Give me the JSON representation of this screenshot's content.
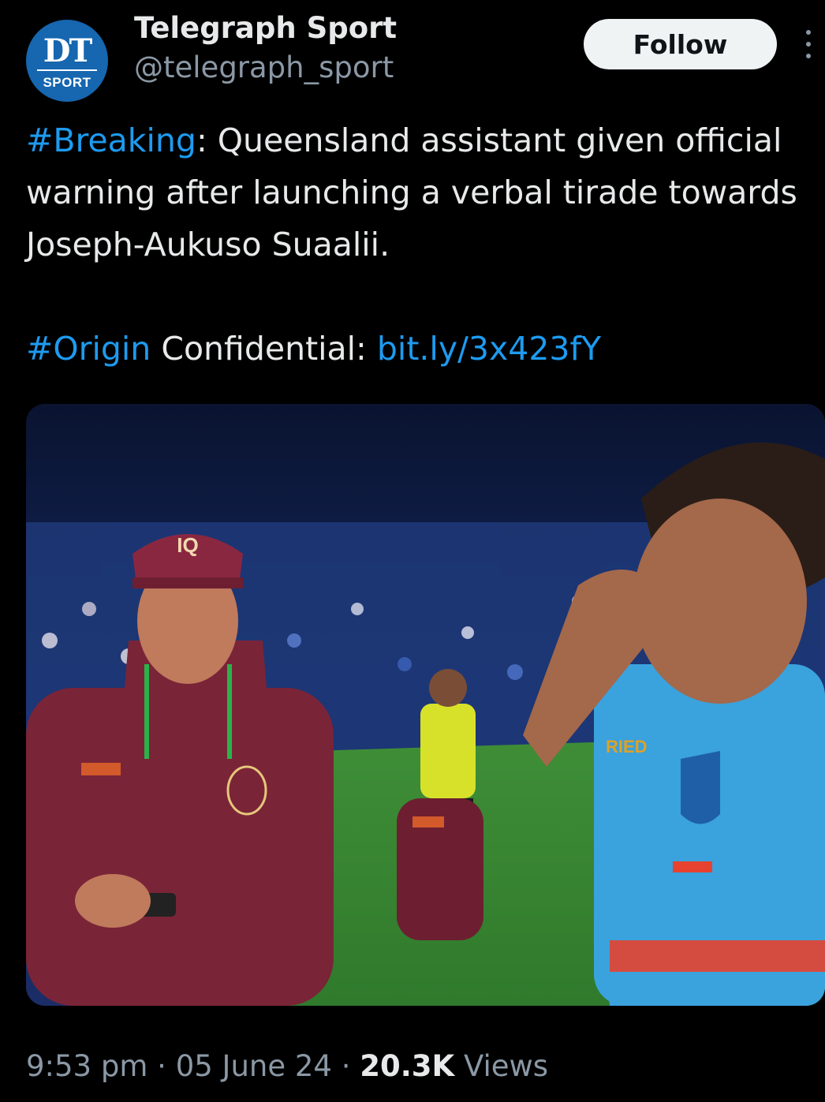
{
  "account": {
    "avatar_line1": "DT",
    "avatar_line2": "SPORT",
    "display_name": "Telegraph Sport",
    "handle": "@telegraph_sport"
  },
  "actions": {
    "follow_label": "Follow",
    "more_icon": "more-vertical-icon"
  },
  "tweet": {
    "hashtag1": "#Breaking",
    "body1": ": Queensland assistant given official warning after launching a verbal tirade towards Joseph-Aukuso Suaalii.",
    "hashtag2": "#Origin",
    "body2": " Confidential: ",
    "link": "bit.ly/3x423fY"
  },
  "media": {
    "cap_logo": "IQ",
    "sign_text": "RIED"
  },
  "meta": {
    "time": "9:53 pm",
    "sep1": " · ",
    "date": "05 June 24",
    "sep2": " · ",
    "views_count": "20.3K",
    "views_label": " Views"
  },
  "colors": {
    "background": "#000000",
    "text": "#e7e9ea",
    "secondary": "#8b98a5",
    "link": "#1d9bf0",
    "avatar_blue": "#1666b0",
    "maroon": "#7a2438",
    "sky_blue": "#3aa2dd"
  }
}
